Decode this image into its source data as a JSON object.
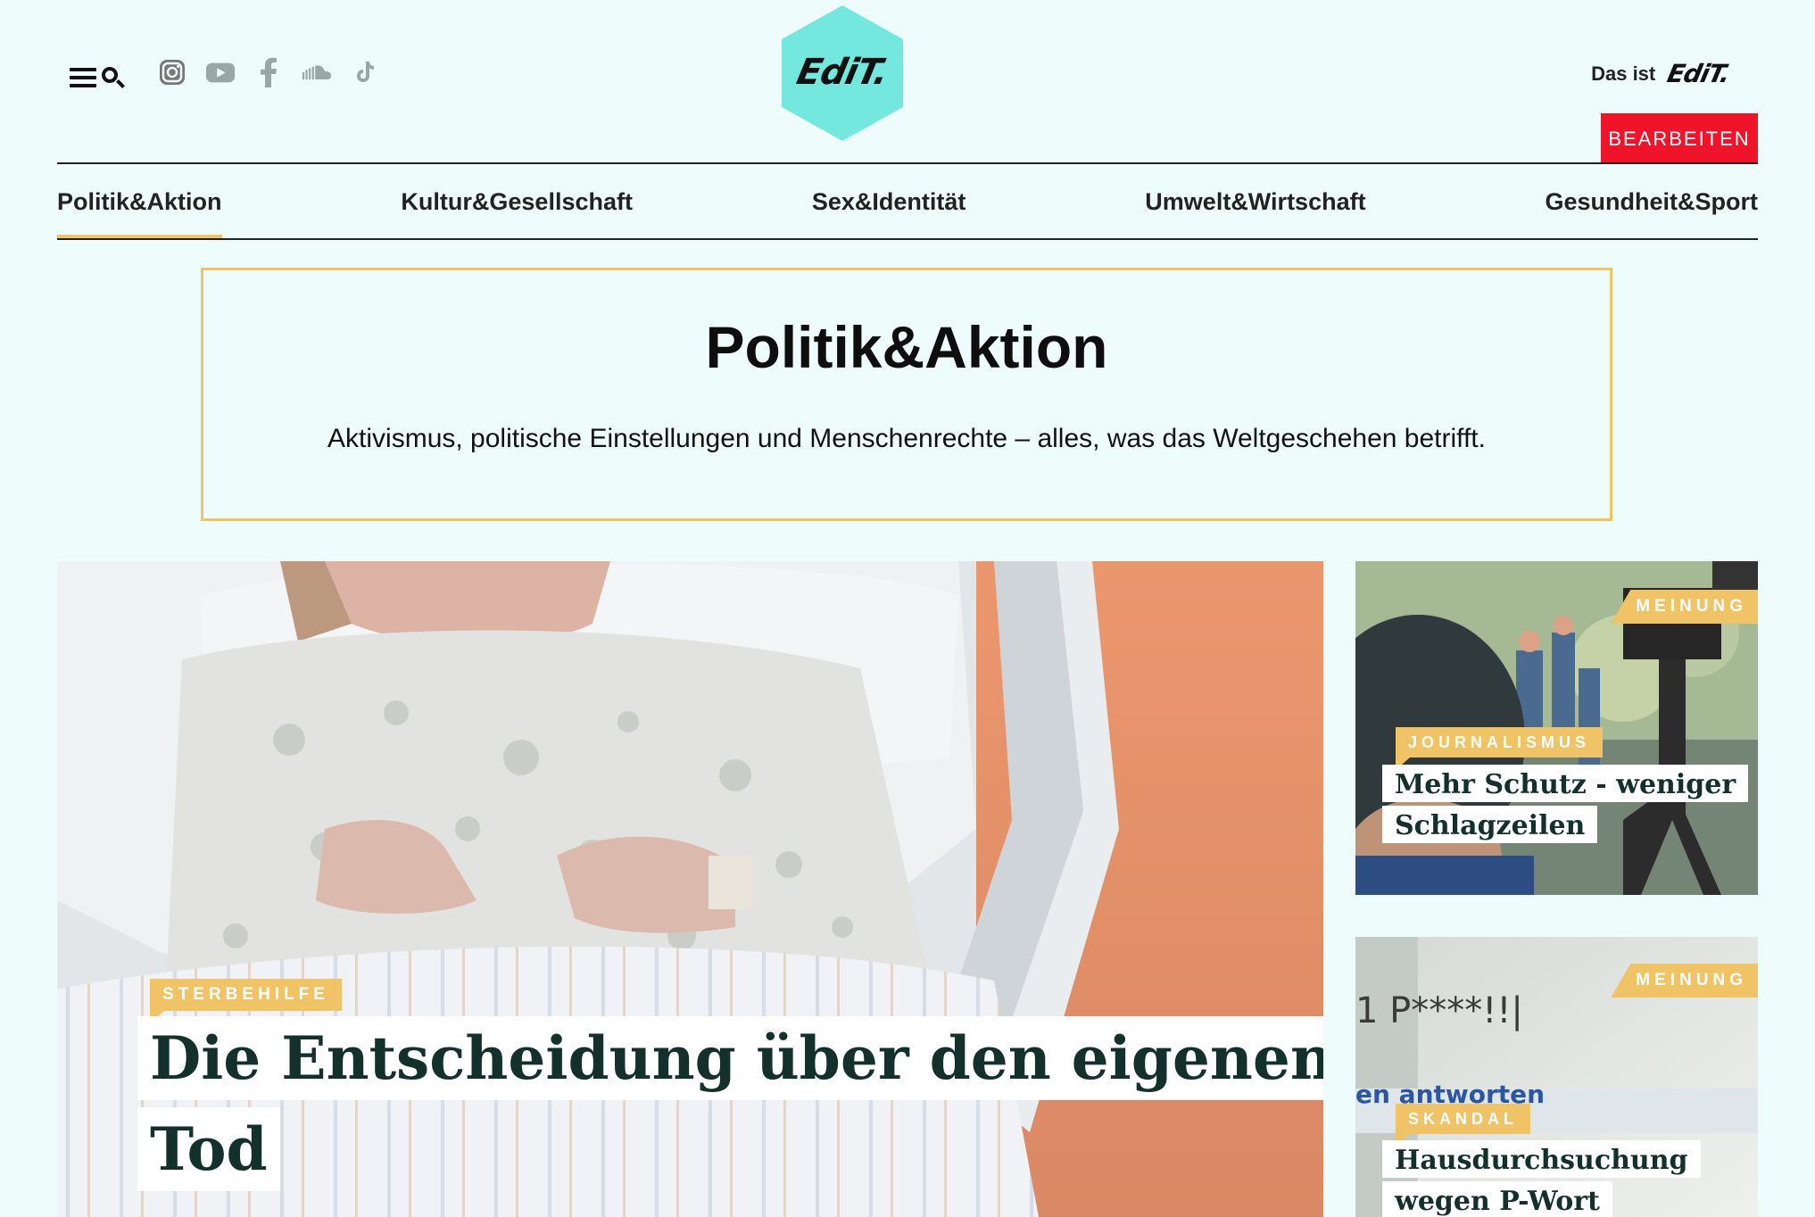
{
  "header": {
    "menu_icon": "hamburger-menu-icon",
    "search_icon": "search-icon",
    "socials": [
      {
        "name": "instagram-icon"
      },
      {
        "name": "youtube-icon"
      },
      {
        "name": "facebook-icon"
      },
      {
        "name": "soundcloud-icon"
      },
      {
        "name": "tiktok-icon"
      }
    ],
    "logo_text": "EdiT.",
    "das_ist_label": "Das ist",
    "das_ist_logo": "EdiT.",
    "edit_button": "BEARBEITEN"
  },
  "colors": {
    "background": "#effcfc",
    "logo_hex": "#74e8df",
    "accent": "#f0c466",
    "edit_button": "#f0142a"
  },
  "nav": {
    "items": [
      {
        "label": "Politik&Aktion",
        "active": true
      },
      {
        "label": "Kultur&Gesellschaft",
        "active": false
      },
      {
        "label": "Sex&Identität",
        "active": false
      },
      {
        "label": "Umwelt&Wirtschaft",
        "active": false
      },
      {
        "label": "Gesundheit&Sport",
        "active": false
      }
    ]
  },
  "category": {
    "title": "Politik&Aktion",
    "description": "Aktivismus, politische Einstellungen und Menschenrechte – alles, was das Weltgeschehen betrifft."
  },
  "feature": {
    "tag": "STERBEHILFE",
    "headline_line1": "Die Entscheidung über den eigenen",
    "headline_line2": "Tod"
  },
  "side_articles": [
    {
      "badge": "MEINUNG",
      "tag": "JOURNALISMUS",
      "headline_line1": "Mehr Schutz - weniger",
      "headline_line2": "Schlagzeilen"
    },
    {
      "badge": "MEINUNG",
      "tag": "SKANDAL",
      "headline_line1": "Hausdurchsuchung",
      "headline_line2": "wegen P-Wort",
      "image_text_1": "1 P****!!|",
      "image_text_2": "en antworten"
    }
  ]
}
